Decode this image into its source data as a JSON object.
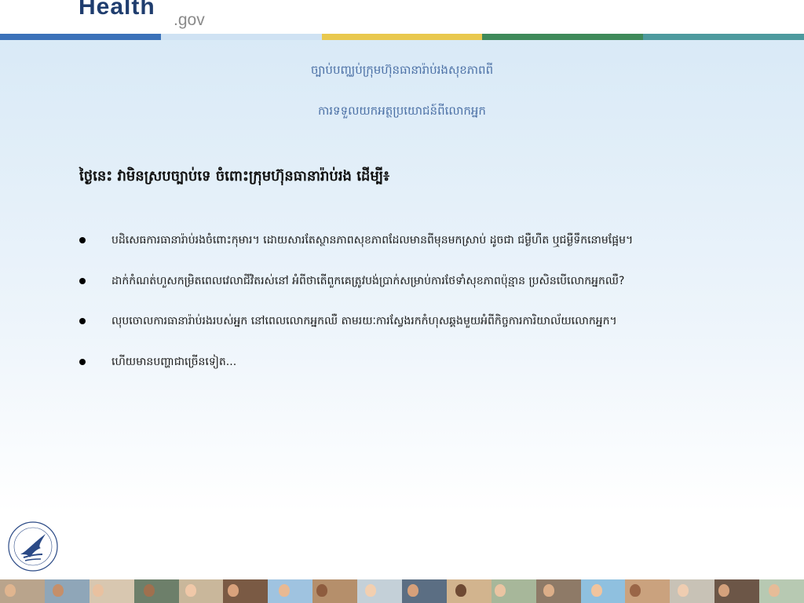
{
  "header": {
    "brand_word": "Health",
    "brand_suffix": ".gov",
    "color_bar": [
      "#3b72b9",
      "#cfe2f3",
      "#e9c84e",
      "#3f8a5a",
      "#4d9a9e"
    ]
  },
  "subtitle": {
    "line1": "ច្បាប់បញ្ឈប់ក្រុមហ៊ុនធានារ៉ាប់រងសុខភាពពី",
    "line2": "ការទទួលយកអត្ថប្រយោជន៍ពីលោកអ្នក"
  },
  "heading": "ថ្ងៃនេះ វាមិនស្របច្បាប់ទេ ចំពោះក្រុមហ៊ុនធានារ៉ាប់រង ដើម្បី៖",
  "bullets": [
    "បដិសេធការធានារ៉ាប់រងចំពោះកុមារ។ ដោយសារតែស្ថានភាពសុខភាពដែលមានពីមុនមកស្រាប់ ដូចជា ជម្ងឺហឺត ឬជម្ងឺទឹកនោមផ្អែម។",
    "ដាក់កំណត់ហួសកម្រិតពេលវេលាជីវិតរស់នៅ អំពីថាតើពួកគេត្រូវបង់ប្រាក់សម្រាប់ការថែទាំសុខភាពប៉ុន្មាន ប្រសិនបើលោកអ្នកឈឺ?",
    "លុបចោលការធានារ៉ាប់រងរបស់អ្នក នៅពេលលោកអ្នកឈឺ តាមរយៈការស្វែងរកកំហុសឆ្គងមួយអំពីកិច្ចការការិយាល័យលោកអ្នក។",
    "ហើយមានបញ្ហាជាច្រើនទៀត..."
  ],
  "icons": {
    "bullet": "bullet-dot-icon",
    "seal": "hhs-seal-icon"
  },
  "colors": {
    "subtitle": "#4a6fa5",
    "heading": "#111111",
    "brand": "#1f3d6e"
  }
}
